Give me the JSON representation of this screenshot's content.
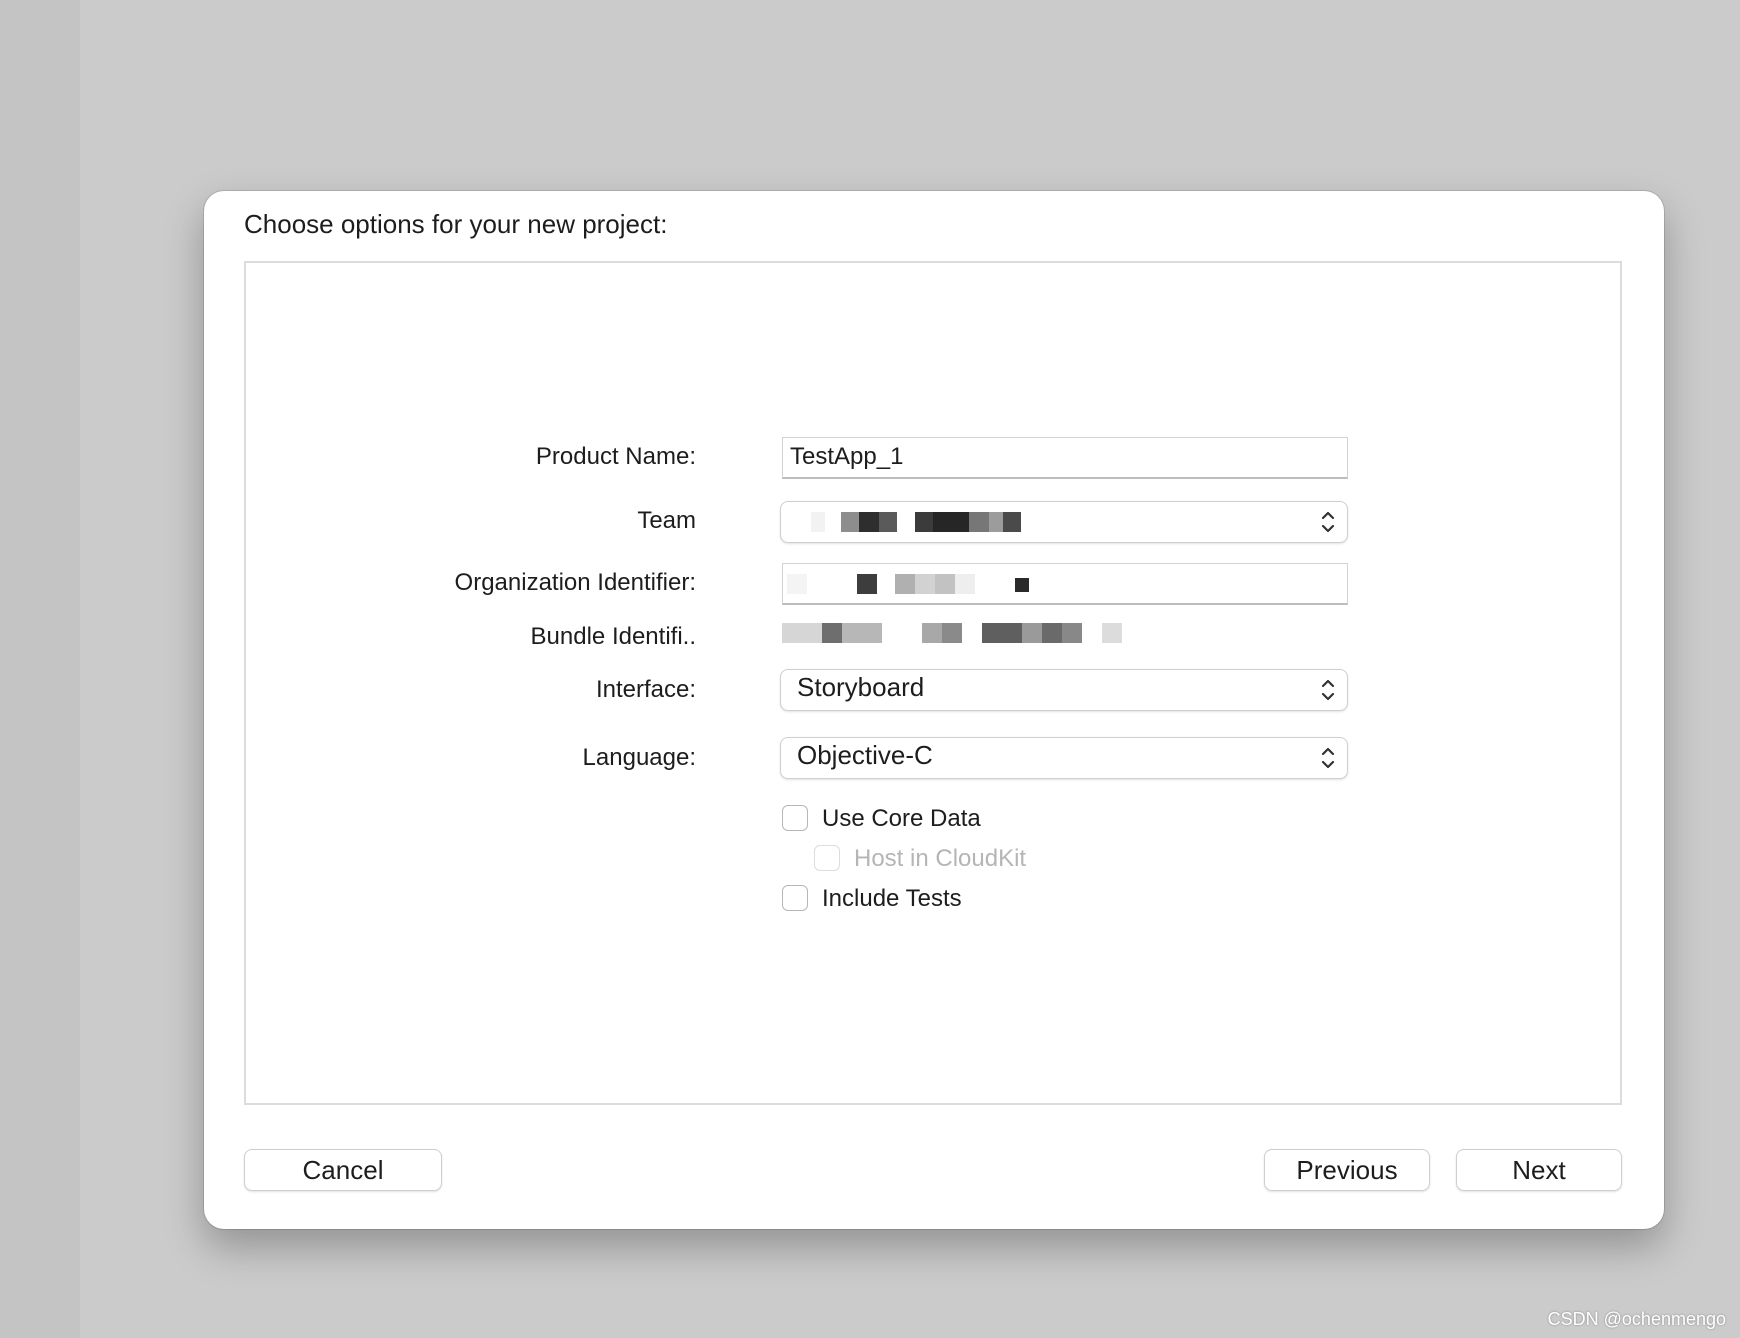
{
  "sheet": {
    "title": "Choose options for your new project:"
  },
  "form": {
    "product_name": {
      "label": "Product Name:",
      "value": "TestApp_1"
    },
    "team": {
      "label": "Team",
      "value": ""
    },
    "organization_identifier": {
      "label": "Organization Identifier:",
      "value": ""
    },
    "bundle_identifier": {
      "label": "Bundle Identifi..",
      "value": ""
    },
    "interface": {
      "label": "Interface:",
      "value": "Storyboard"
    },
    "language": {
      "label": "Language:",
      "value": "Objective-C"
    },
    "use_core_data": {
      "label": "Use Core Data",
      "checked": false
    },
    "host_in_cloudkit": {
      "label": "Host in CloudKit",
      "checked": false,
      "enabled": false
    },
    "include_tests": {
      "label": "Include Tests",
      "checked": false
    }
  },
  "buttons": {
    "cancel": "Cancel",
    "previous": "Previous",
    "next": "Next"
  },
  "watermark": "CSDN @ochenmengo",
  "colors": {
    "desktop_background": "#cbcbcb",
    "sheet_background": "#ffffff",
    "disabled_text": "#b5b5b5"
  },
  "icons": {
    "popup_indicator": "chevron-up-down-icon"
  }
}
